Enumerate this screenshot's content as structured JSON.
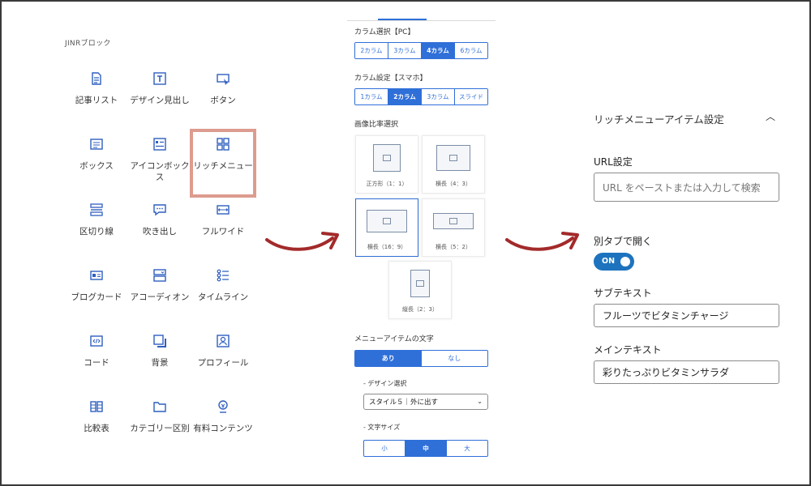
{
  "palette": {
    "title": "JINRブロック",
    "blocks": [
      {
        "label": "記事リスト",
        "icon": "article-list-icon"
      },
      {
        "label": "デザイン見出し",
        "icon": "heading-icon"
      },
      {
        "label": "ボタン",
        "icon": "button-icon"
      },
      {
        "label": "ボックス",
        "icon": "box-icon"
      },
      {
        "label": "アイコンボックス",
        "icon": "icon-box-icon"
      },
      {
        "label": "リッチメニュー",
        "icon": "rich-menu-icon"
      },
      {
        "label": "区切り線",
        "icon": "divider-icon"
      },
      {
        "label": "吹き出し",
        "icon": "speech-bubble-icon"
      },
      {
        "label": "フルワイド",
        "icon": "full-wide-icon"
      },
      {
        "label": "ブログカード",
        "icon": "blog-card-icon"
      },
      {
        "label": "アコーディオン",
        "icon": "accordion-icon"
      },
      {
        "label": "タイムライン",
        "icon": "timeline-icon"
      },
      {
        "label": "コード",
        "icon": "code-icon"
      },
      {
        "label": "背景",
        "icon": "background-icon"
      },
      {
        "label": "プロフィール",
        "icon": "profile-icon"
      },
      {
        "label": "比較表",
        "icon": "comparison-table-icon"
      },
      {
        "label": "カテゴリー区別",
        "icon": "category-icon"
      },
      {
        "label": "有料コンテンツ",
        "icon": "paid-content-icon"
      }
    ],
    "highlighted": "リッチメニュー"
  },
  "middle": {
    "column_pc": {
      "label": "カラム選択【PC】",
      "options": [
        "2カラム",
        "3カラム",
        "4カラム",
        "6カラム"
      ],
      "selected": "4カラム"
    },
    "column_sp": {
      "label": "カラム設定【スマホ】",
      "options": [
        "1カラム",
        "2カラム",
        "3カラム",
        "スライド"
      ],
      "selected": "2カラム"
    },
    "ratio": {
      "label": "画像比率選択",
      "options": [
        "正方形（1：1）",
        "横長（4：3）",
        "横長（16：9）",
        "横長（5：2）",
        "縦長（2：3）"
      ],
      "selected": "横長（16：9）"
    },
    "menu_text": {
      "label": "メニューアイテムの文字",
      "options": [
        "あり",
        "なし"
      ],
      "selected": "あり"
    },
    "design": {
      "label": "- デザイン選択",
      "value": "スタイル５｜外に出す"
    },
    "font_size": {
      "label": "- 文字サイズ",
      "options": [
        "小",
        "中",
        "大"
      ],
      "selected": "中"
    }
  },
  "right": {
    "title": "リッチメニューアイテム設定",
    "url": {
      "label": "URL設定",
      "placeholder": "URL をペーストまたは入力して検索"
    },
    "new_tab": {
      "label": "別タブで開く",
      "state": "ON"
    },
    "subtext": {
      "label": "サブテキスト",
      "value": "フルーツでビタミンチャージ"
    },
    "maintext": {
      "label": "メインテキスト",
      "value": "彩りたっぷりビタミンサラダ"
    }
  },
  "colors": {
    "accent": "#2f6fd8",
    "toggle": "#1e73be",
    "highlight": "#dc9c8f",
    "arrow": "#a32a2a"
  }
}
